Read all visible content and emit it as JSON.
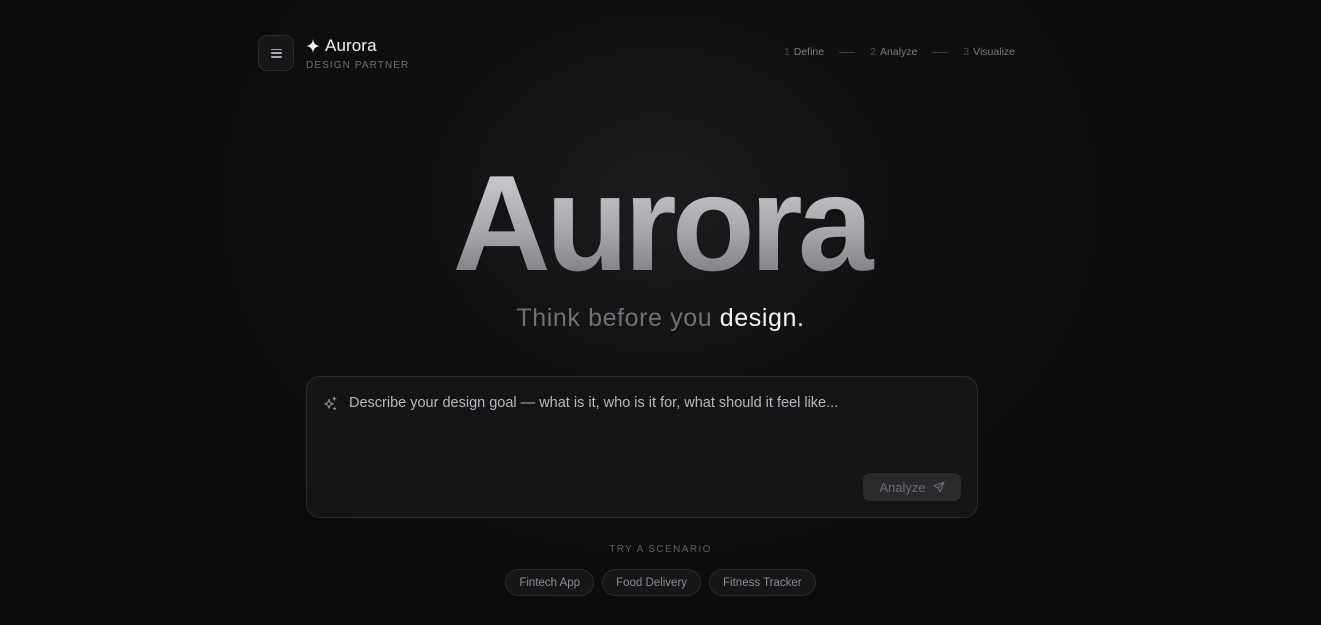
{
  "brand": {
    "name": "Aurora",
    "subtitle": "DESIGN PARTNER",
    "icon": "four-point-star-icon"
  },
  "menu": {
    "icon": "hamburger-icon"
  },
  "steps": [
    {
      "num": "1",
      "label": "Define"
    },
    {
      "num": "2",
      "label": "Analyze"
    },
    {
      "num": "3",
      "label": "Visualize"
    }
  ],
  "hero": {
    "title": "Aurora",
    "tagline_prefix": "Think before you",
    "tagline_accent": "design."
  },
  "composer": {
    "placeholder": "Describe your design goal — what is it, who is it for, what should it feel like...",
    "value": "",
    "sparkle_icon": "sparkle-icon",
    "submit_label": "Analyze",
    "submit_icon": "send-icon"
  },
  "scenarios": {
    "label": "TRY A SCENARIO",
    "items": [
      "Fintech App",
      "Food Delivery",
      "Fitness Tracker"
    ]
  },
  "colors": {
    "background": "#0b0b0c",
    "surface": "#141416",
    "border": "#2b2b2e",
    "text_primary": "#f2f2f2",
    "text_muted": "#707075"
  }
}
